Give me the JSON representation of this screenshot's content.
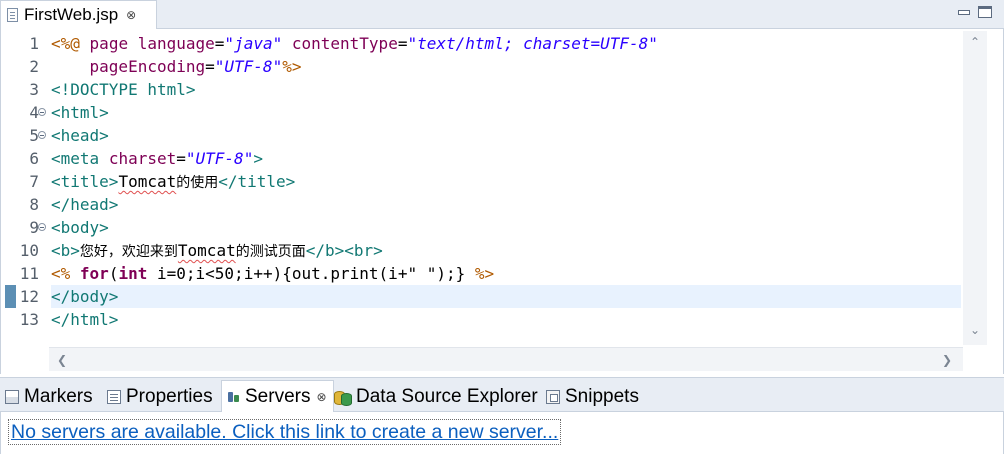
{
  "editor": {
    "tab_title": "FirstWeb.jsp",
    "tab_close": "⊗",
    "lines": [
      {
        "num": "1",
        "fold": false,
        "current": false,
        "tokens": [
          {
            "t": "<%@",
            "c": "jsp"
          },
          {
            "t": " ",
            "c": "text"
          },
          {
            "t": "page",
            "c": "attr"
          },
          {
            "t": " ",
            "c": "text"
          },
          {
            "t": "language",
            "c": "attr"
          },
          {
            "t": "=",
            "c": "text"
          },
          {
            "t": "\"java\"",
            "c": "str"
          },
          {
            "t": " ",
            "c": "text"
          },
          {
            "t": "contentType",
            "c": "attr"
          },
          {
            "t": "=",
            "c": "text"
          },
          {
            "t": "\"text/html; charset=UTF-8\"",
            "c": "str"
          }
        ]
      },
      {
        "num": "2",
        "fold": false,
        "current": false,
        "tokens": [
          {
            "t": "    ",
            "c": "text"
          },
          {
            "t": "pageEncoding",
            "c": "attr"
          },
          {
            "t": "=",
            "c": "text"
          },
          {
            "t": "\"UTF-8\"",
            "c": "str"
          },
          {
            "t": "%>",
            "c": "jsp"
          }
        ]
      },
      {
        "num": "3",
        "fold": false,
        "current": false,
        "tokens": [
          {
            "t": "<!DOCTYPE",
            "c": "tag"
          },
          {
            "t": " ",
            "c": "text"
          },
          {
            "t": "html",
            "c": "tag"
          },
          {
            "t": ">",
            "c": "tag"
          }
        ]
      },
      {
        "num": "4",
        "fold": true,
        "current": false,
        "tokens": [
          {
            "t": "<html>",
            "c": "tag"
          }
        ]
      },
      {
        "num": "5",
        "fold": true,
        "current": false,
        "tokens": [
          {
            "t": "<head>",
            "c": "tag"
          }
        ]
      },
      {
        "num": "6",
        "fold": false,
        "current": false,
        "tokens": [
          {
            "t": "<meta",
            "c": "tag"
          },
          {
            "t": " ",
            "c": "text"
          },
          {
            "t": "charset",
            "c": "attr"
          },
          {
            "t": "=",
            "c": "text"
          },
          {
            "t": "\"UTF-8\"",
            "c": "str"
          },
          {
            "t": ">",
            "c": "tag"
          }
        ]
      },
      {
        "num": "7",
        "fold": false,
        "current": false,
        "tokens": [
          {
            "t": "<title>",
            "c": "tag"
          },
          {
            "t": "Tomcat",
            "c": "squig"
          },
          {
            "t": "的使用",
            "c": "cjk"
          },
          {
            "t": "</title>",
            "c": "tag"
          }
        ]
      },
      {
        "num": "8",
        "fold": false,
        "current": false,
        "tokens": [
          {
            "t": "</head>",
            "c": "tag"
          }
        ]
      },
      {
        "num": "9",
        "fold": true,
        "current": false,
        "tokens": [
          {
            "t": "<body>",
            "c": "tag"
          }
        ]
      },
      {
        "num": "10",
        "fold": false,
        "current": false,
        "tokens": [
          {
            "t": "<b>",
            "c": "tag"
          },
          {
            "t": "您好，欢迎来到",
            "c": "cjk"
          },
          {
            "t": "Tomcat",
            "c": "squig"
          },
          {
            "t": "的测试页面",
            "c": "cjk"
          },
          {
            "t": "</b><br>",
            "c": "tag"
          }
        ]
      },
      {
        "num": "11",
        "fold": false,
        "current": false,
        "tokens": [
          {
            "t": "<%",
            "c": "jsp"
          },
          {
            "t": " ",
            "c": "text"
          },
          {
            "t": "for",
            "c": "kw"
          },
          {
            "t": "(",
            "c": "text"
          },
          {
            "t": "int",
            "c": "kw"
          },
          {
            "t": " i=0;i<50;i++){out.print(i+\" \");} ",
            "c": "text"
          },
          {
            "t": "%>",
            "c": "jsp"
          }
        ]
      },
      {
        "num": "12",
        "fold": false,
        "current": true,
        "tokens": [
          {
            "t": "</body>",
            "c": "tag"
          }
        ]
      },
      {
        "num": "13",
        "fold": false,
        "current": false,
        "tokens": [
          {
            "t": "</html>",
            "c": "tag"
          }
        ]
      }
    ]
  },
  "views": {
    "tabs": [
      {
        "name": "markers",
        "label": "Markers",
        "icon": "markers-icon",
        "active": false
      },
      {
        "name": "properties",
        "label": "Properties",
        "icon": "properties-icon",
        "active": false
      },
      {
        "name": "servers",
        "label": "Servers",
        "icon": "servers-icon",
        "active": true
      },
      {
        "name": "data-source-explorer",
        "label": "Data Source Explorer",
        "icon": "database-icon",
        "active": false
      },
      {
        "name": "snippets",
        "label": "Snippets",
        "icon": "snippets-icon",
        "active": false
      }
    ],
    "close_glyph": "⊗",
    "servers_link": "No servers are available. Click this link to create a new server..."
  },
  "colors": {
    "jsp_delimiter": "#b05a00",
    "attribute": "#7e0055",
    "string": "#2a00ff",
    "tag": "#117873",
    "keyword": "#7f0055",
    "current_line": "#e8f2fe",
    "link": "#0b5fbf"
  }
}
